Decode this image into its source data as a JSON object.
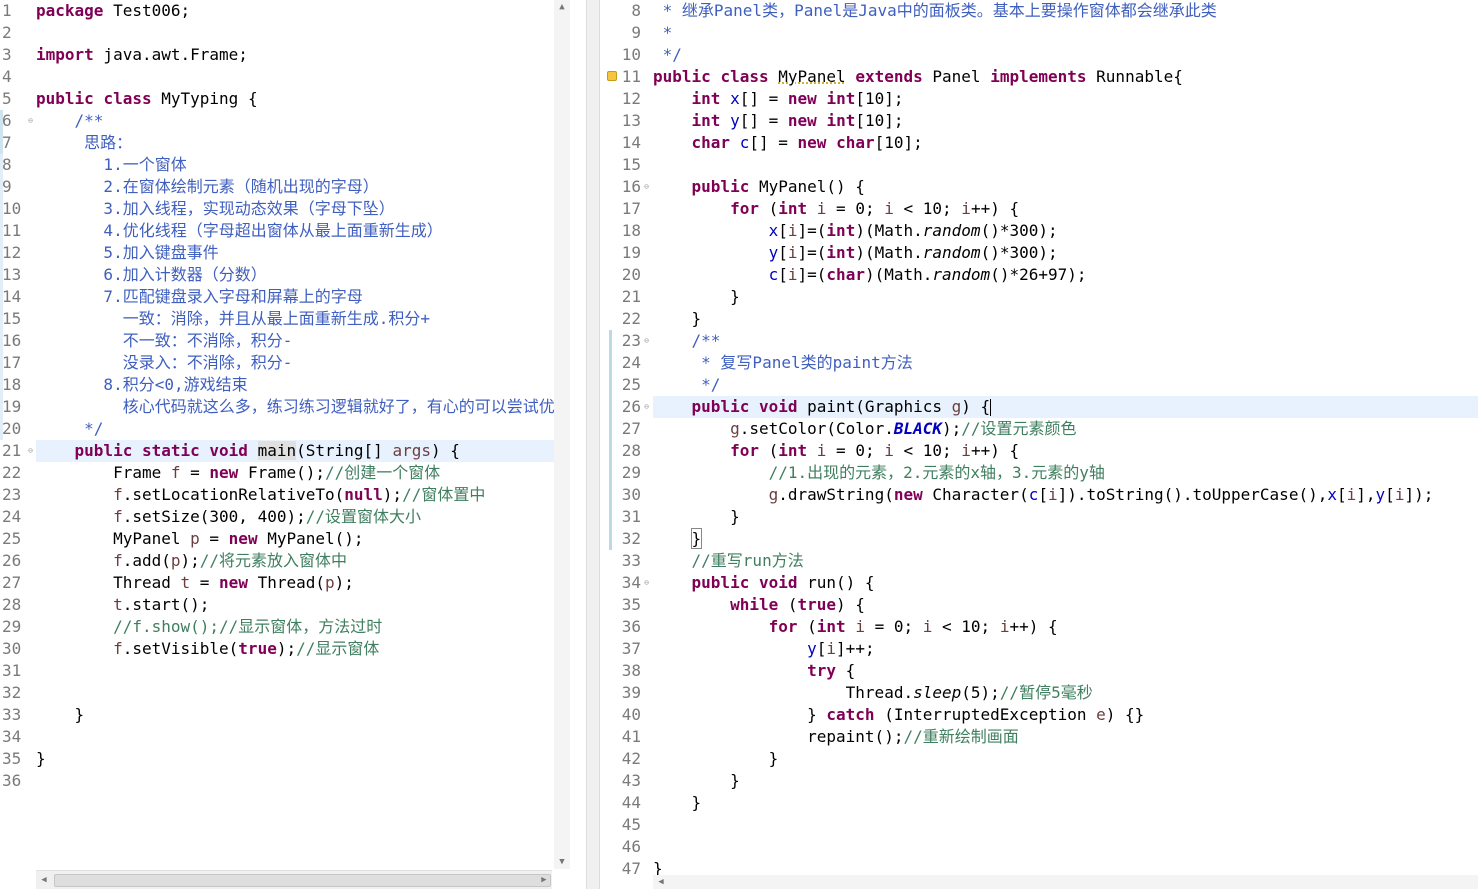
{
  "left_editor": {
    "first_line": 1,
    "lines": [
      "<span class=\"kw\">package</span> Test006;",
      "",
      "<span class=\"kw\">import</span> java.awt.Frame;",
      "",
      "<span class=\"kw\">public</span> <span class=\"kw\">class</span> MyTyping {",
      "    <span class=\"jd\">/**</span>",
      "<span class=\"jd\">     思路：</span>",
      "<span class=\"jd\">       1.一个窗体</span>",
      "<span class=\"jd\">       2.在窗体绘制元素（随机出现的字母）</span>",
      "<span class=\"jd\">       3.加入线程，实现动态效果（字母下坠）</span>",
      "<span class=\"jd\">       4.优化线程（字母超出窗体从最上面重新生成）</span>",
      "<span class=\"jd\">       5.加入键盘事件</span>",
      "<span class=\"jd\">       6.加入计数器（分数）</span>",
      "<span class=\"jd\">       7.匹配键盘录入字母和屏幕上的字母</span>",
      "<span class=\"jd\">         一致：消除，并且从最上面重新生成.积分+</span>",
      "<span class=\"jd\">         不一致：不消除，积分-</span>",
      "<span class=\"jd\">         没录入：不消除，积分-</span>",
      "<span class=\"jd\">       8.积分&lt;0,游戏结束</span>",
      "<span class=\"jd\">         核心代码就这么多，练习练习逻辑就好了，有心的可以尝试优化下！</span>",
      "<span class=\"jd\">     */</span>",
      "    <span class=\"kw\">public</span> <span class=\"kw\">static</span> <span class=\"kw\">void</span> <span class=\"hl-word\">main</span>(String[] <span class=\"var\">args</span>) {",
      "        Frame <span class=\"var\">f</span> = <span class=\"kw\">new</span> Frame();<span class=\"cm\">//创建一个窗体</span>",
      "        <span class=\"var\">f</span>.setLocationRelativeTo(<span class=\"kw\">null</span>);<span class=\"cm\">//窗体置中</span>",
      "        <span class=\"var\">f</span>.setSize(300, 400);<span class=\"cm\">//设置窗体大小</span>",
      "        MyPanel <span class=\"var\">p</span> = <span class=\"kw\">new</span> MyPanel();",
      "        <span class=\"var\">f</span>.add(<span class=\"var\">p</span>);<span class=\"cm\">//将元素放入窗体中</span>",
      "        Thread <span class=\"var\">t</span> = <span class=\"kw\">new</span> Thread(<span class=\"var\">p</span>);",
      "        <span class=\"var\">t</span>.start();",
      "        <span class=\"cm\">//f.show();//显示窗体，方法过时</span>",
      "        <span class=\"var\">f</span>.setVisible(<span class=\"kw\">true</span>);<span class=\"cm\">//显示窗体</span>",
      "",
      "",
      "    }",
      "",
      "}",
      ""
    ]
  },
  "right_editor": {
    "first_line": 8,
    "lines": [
      "<span class=\"jd\"> * 继承Panel类，Panel是Java中的面板类。基本上要操作窗体都会继承此类</span>",
      "<span class=\"jd\"> *</span>",
      "<span class=\"jd\"> */</span>",
      "<span class=\"kw\">public</span> <span class=\"kw\">class</span> <span style=\"text-decoration:underline dotted #c8a000\">MyPanel</span> <span class=\"kw\">extends</span> Panel <span class=\"kw\">implements</span> Runnable{",
      "    <span class=\"kw\">int</span> <span class=\"fld\">x</span>[] = <span class=\"kw\">new</span> <span class=\"kw\">int</span>[10];",
      "    <span class=\"kw\">int</span> <span class=\"fld\">y</span>[] = <span class=\"kw\">new</span> <span class=\"kw\">int</span>[10];",
      "    <span class=\"kw\">char</span> <span class=\"fld\">c</span>[] = <span class=\"kw\">new</span> <span class=\"kw\">char</span>[10];",
      "",
      "    <span class=\"kw\">public</span> MyPanel() {",
      "        <span class=\"kw\">for</span> (<span class=\"kw\">int</span> <span class=\"var\">i</span> = 0; <span class=\"var\">i</span> &lt; 10; <span class=\"var\">i</span>++) {",
      "            <span class=\"fld\">x</span>[<span class=\"var\">i</span>]=(<span class=\"kw\">int</span>)(Math.<span class=\"it\">random</span>()*300);",
      "            <span class=\"fld\">y</span>[<span class=\"var\">i</span>]=(<span class=\"kw\">int</span>)(Math.<span class=\"it\">random</span>()*300);",
      "            <span class=\"fld\">c</span>[<span class=\"var\">i</span>]=(<span class=\"kw\">char</span>)(Math.<span class=\"it\">random</span>()*26+97);",
      "        }",
      "    }",
      "    <span class=\"jd\">/**</span>",
      "<span class=\"jd\">     * 复写Panel类的paint方法</span>",
      "<span class=\"jd\">     */</span>",
      "    <span class=\"kw\">public</span> <span class=\"kw\">void</span> paint(Graphics <span class=\"var\">g</span>) {<span class=\"caret\"></span>",
      "        <span class=\"var\">g</span>.setColor(Color.<span class=\"cnst\">BLACK</span>);<span class=\"cm\">//设置元素颜色</span>",
      "        <span class=\"kw\">for</span> (<span class=\"kw\">int</span> <span class=\"var\">i</span> = 0; <span class=\"var\">i</span> &lt; 10; <span class=\"var\">i</span>++) {",
      "            <span class=\"cm\">//1.出现的元素，2.元素的x轴，3.元素的y轴</span>",
      "            <span class=\"var\">g</span>.drawString(<span class=\"kw\">new</span> Character(<span class=\"fld\">c</span>[<span class=\"var\">i</span>]).toString().toUpperCase(),<span class=\"fld\">x</span>[<span class=\"var\">i</span>],<span class=\"fld\">y</span>[<span class=\"var\">i</span>]);",
      "        }",
      "    <span class=\"box\">}</span>",
      "    <span class=\"cm\">//重写run方法</span>",
      "    <span class=\"kw\">public</span> <span class=\"kw\">void</span> run() {",
      "        <span class=\"kw\">while</span> (<span class=\"kw\">true</span>) {",
      "            <span class=\"kw\">for</span> (<span class=\"kw\">int</span> <span class=\"var\">i</span> = 0; <span class=\"var\">i</span> &lt; 10; <span class=\"var\">i</span>++) {",
      "                <span class=\"fld\">y</span>[<span class=\"var\">i</span>]++;",
      "                <span class=\"kw\">try</span> {",
      "                    Thread.<span class=\"it\">sleep</span>(5);<span class=\"cm\">//暂停5毫秒</span>",
      "                } <span class=\"kw\">catch</span> (InterruptedException <span class=\"var\">e</span>) {}",
      "                repaint();<span class=\"cm\">//重新绘制画面</span>",
      "            }",
      "        }",
      "    }",
      "",
      "",
      "}"
    ]
  }
}
